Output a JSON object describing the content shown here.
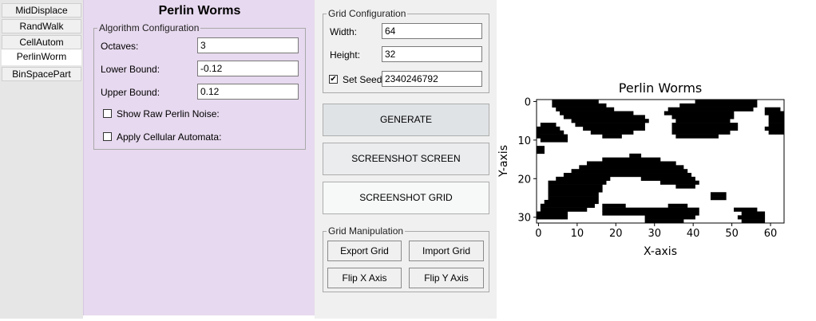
{
  "tabs": [
    "MidDisplace",
    "RandWalk",
    "CellAutom",
    "PerlinWorm",
    "BinSpacePart"
  ],
  "active_tab": "PerlinWorm",
  "algorithm": {
    "title": "Perlin Worms",
    "group_title": "Algorithm Configuration",
    "octaves_label": "Octaves:",
    "octaves_value": "3",
    "lower_label": "Lower Bound:",
    "lower_value": "-0.12",
    "upper_label": "Upper Bound:",
    "upper_value": "0.12",
    "raw_noise_label": "Show Raw Perlin Noise:",
    "raw_noise_checked": false,
    "cellular_label": "Apply Cellular Automata:",
    "cellular_checked": false
  },
  "grid_config": {
    "group_title": "Grid Configuration",
    "width_label": "Width:",
    "width_value": "64",
    "height_label": "Height:",
    "height_value": "32",
    "seed_label": "Set Seed",
    "seed_checked": true,
    "seed_value": "2340246792"
  },
  "actions": {
    "generate": "GENERATE",
    "screenshot_screen": "SCREENSHOT SCREEN",
    "screenshot_grid": "SCREENSHOT GRID"
  },
  "grid_manipulation": {
    "group_title": "Grid Manipulation",
    "export": "Export Grid",
    "import": "Import Grid",
    "flip_x": "Flip X Axis",
    "flip_y": "Flip Y Axis"
  },
  "chart_data": {
    "type": "heatmap",
    "title": "Perlin Worms",
    "xlabel": "X-axis",
    "ylabel": "Y-axis",
    "x_ticks": [
      0,
      10,
      20,
      30,
      40,
      50,
      60
    ],
    "y_ticks": [
      0,
      10,
      20,
      30
    ],
    "xlim": [
      -0.5,
      63.5
    ],
    "ylim": [
      31.5,
      -0.5
    ],
    "colors": {
      "filled": "#000000",
      "empty": "#ffffff"
    },
    "grid_width": 64,
    "grid_height": 32,
    "filled_cells": [
      [
        0,
        4,
        15
      ],
      [
        0,
        41,
        56
      ],
      [
        1,
        4,
        17
      ],
      [
        1,
        37,
        56
      ],
      [
        2,
        5,
        19
      ],
      [
        2,
        34,
        55
      ],
      [
        2,
        59,
        62
      ],
      [
        3,
        6,
        24
      ],
      [
        3,
        33,
        50
      ],
      [
        3,
        59,
        63
      ],
      [
        4,
        7,
        27
      ],
      [
        4,
        35,
        50
      ],
      [
        4,
        60,
        63
      ],
      [
        5,
        9,
        28
      ],
      [
        5,
        36,
        49
      ],
      [
        5,
        60,
        63
      ],
      [
        6,
        1,
        4
      ],
      [
        6,
        10,
        27
      ],
      [
        6,
        35,
        51
      ],
      [
        6,
        60,
        63
      ],
      [
        7,
        0,
        5
      ],
      [
        7,
        12,
        27
      ],
      [
        7,
        35,
        51
      ],
      [
        7,
        59,
        63
      ],
      [
        8,
        0,
        6
      ],
      [
        8,
        14,
        24
      ],
      [
        8,
        35,
        49
      ],
      [
        8,
        60,
        63
      ],
      [
        9,
        0,
        7
      ],
      [
        9,
        17,
        21
      ],
      [
        9,
        36,
        46
      ],
      [
        10,
        1,
        7
      ],
      [
        12,
        0,
        1
      ],
      [
        13,
        0,
        1
      ],
      [
        14,
        24,
        26
      ],
      [
        15,
        17,
        31
      ],
      [
        16,
        13,
        35
      ],
      [
        17,
        11,
        37
      ],
      [
        18,
        9,
        38
      ],
      [
        19,
        7,
        39
      ],
      [
        20,
        5,
        18
      ],
      [
        20,
        27,
        40
      ],
      [
        21,
        3,
        17
      ],
      [
        21,
        32,
        41
      ],
      [
        22,
        3,
        16
      ],
      [
        22,
        36,
        40
      ],
      [
        23,
        3,
        16
      ],
      [
        24,
        3,
        15
      ],
      [
        24,
        45,
        48
      ],
      [
        25,
        3,
        15
      ],
      [
        25,
        45,
        48
      ],
      [
        26,
        2,
        15
      ],
      [
        27,
        1,
        14
      ],
      [
        27,
        17,
        22
      ],
      [
        27,
        34,
        38
      ],
      [
        28,
        1,
        12
      ],
      [
        28,
        17,
        41
      ],
      [
        28,
        51,
        56
      ],
      [
        29,
        0,
        7
      ],
      [
        29,
        17,
        41
      ],
      [
        29,
        53,
        58
      ],
      [
        30,
        0,
        7
      ],
      [
        30,
        28,
        40
      ],
      [
        30,
        52,
        58
      ],
      [
        31,
        28,
        37
      ],
      [
        31,
        53,
        58
      ]
    ]
  }
}
